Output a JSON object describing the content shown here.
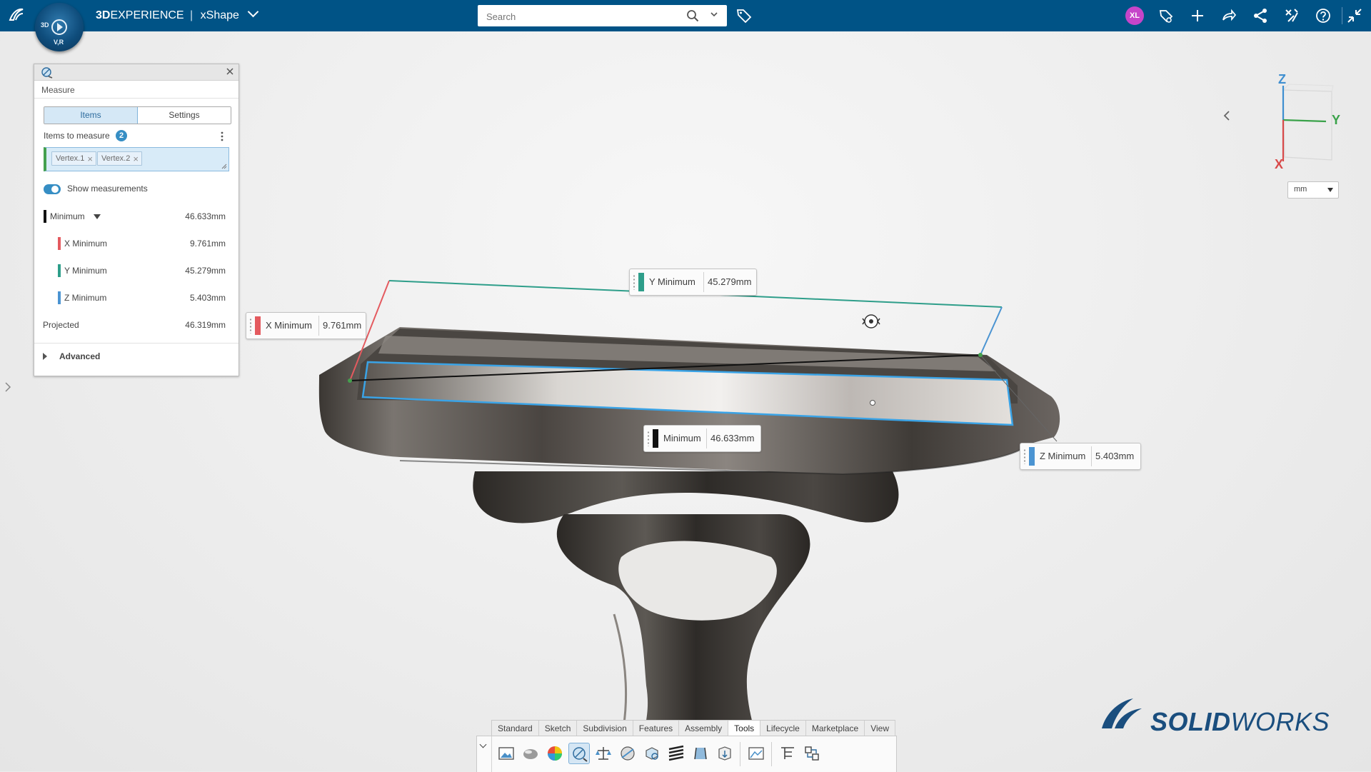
{
  "header": {
    "brand_bold": "3D",
    "brand_rest": "EXPERIENCE",
    "separator": "|",
    "app_name": "xShape",
    "compass_labels": [
      "3D",
      "V,R"
    ],
    "search_placeholder": "Search",
    "avatar_initials": "XL",
    "colors": {
      "bar": "#005386",
      "avatar": "#c645c9"
    }
  },
  "panel": {
    "title": "Measure",
    "tabs": [
      {
        "label": "Items",
        "active": true
      },
      {
        "label": "Settings",
        "active": false
      }
    ],
    "items_label": "Items to measure",
    "items_count": "2",
    "chips": [
      "Vertex.1",
      "Vertex.2"
    ],
    "show_measurements_label": "Show measurements",
    "show_measurements_on": true,
    "rows": [
      {
        "label": "Minimum",
        "value": "46.633mm",
        "color": "#111111"
      },
      {
        "label": "X Minimum",
        "value": "9.761mm",
        "color": "#e45a5f"
      },
      {
        "label": "Y Minimum",
        "value": "45.279mm",
        "color": "#2e9e8a"
      },
      {
        "label": "Z Minimum",
        "value": "5.403mm",
        "color": "#4b94d2"
      },
      {
        "label": "Projected",
        "value": "46.319mm",
        "color": ""
      }
    ],
    "advanced_label": "Advanced"
  },
  "measure_labels": {
    "y_min": {
      "name": "Y Minimum",
      "value": "45.279mm",
      "color": "#2e9e8a"
    },
    "x_min": {
      "name": "X Minimum",
      "value": "9.761mm",
      "color": "#e45a5f"
    },
    "min": {
      "name": "Minimum",
      "value": "46.633mm",
      "color": "#111111"
    },
    "z_min": {
      "name": "Z Minimum",
      "value": "5.403mm",
      "color": "#4b94d2"
    }
  },
  "triad": {
    "z": "Z",
    "y": "Y",
    "x": "X"
  },
  "unit": "mm",
  "logo": {
    "solid": "SOLID",
    "works": "WORKS"
  },
  "action_bar": {
    "tabs": [
      "Standard",
      "Sketch",
      "Subdivision",
      "Features",
      "Assembly",
      "Tools",
      "Lifecycle",
      "Marketplace",
      "View"
    ],
    "active_tab": "Tools",
    "tools": [
      "capture-image-icon",
      "material-sphere-icon",
      "color-wheel-icon",
      "measure-icon",
      "mass-properties-icon",
      "section-icon",
      "check-geometry-icon",
      "zebra-icon",
      "draft-analysis-icon",
      "export-icon",
      "render-image-icon",
      "filter-tree-icon",
      "compare-icon"
    ]
  }
}
